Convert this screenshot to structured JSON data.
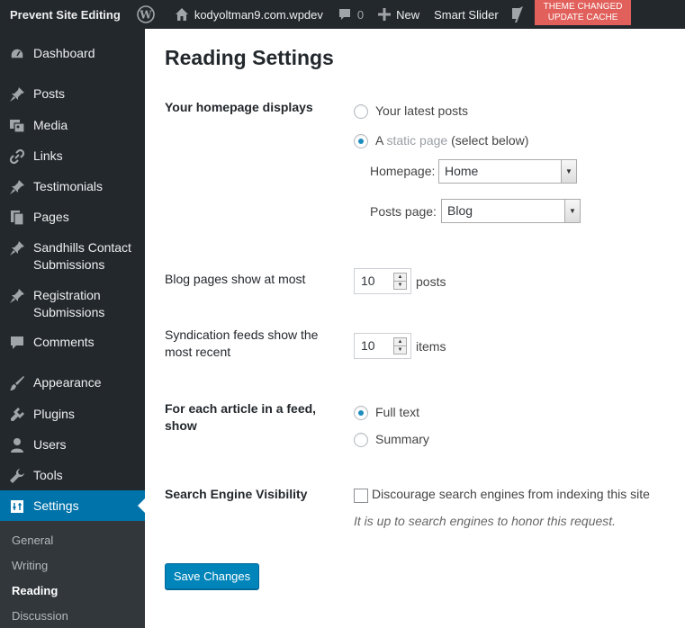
{
  "adminbar": {
    "brand": "Prevent Site Editing",
    "site_name": "kodyoltman9.com.wpdev",
    "comments_count": "0",
    "new_label": "New",
    "smart_slider_label": "Smart Slider",
    "theme_alert_line1": "THEME CHANGED",
    "theme_alert_line2": "UPDATE CACHE"
  },
  "sidebar": {
    "items": [
      {
        "label": "Dashboard",
        "icon": "dashboard-icon"
      },
      {
        "label": "Posts",
        "icon": "pin-icon"
      },
      {
        "label": "Media",
        "icon": "media-icon"
      },
      {
        "label": "Links",
        "icon": "link-icon"
      },
      {
        "label": "Testimonials",
        "icon": "pin-icon"
      },
      {
        "label": "Pages",
        "icon": "pages-icon"
      },
      {
        "label": "Sandhills Contact Submissions",
        "icon": "pin-icon"
      },
      {
        "label": "Registration Submissions",
        "icon": "pin-icon"
      },
      {
        "label": "Comments",
        "icon": "comment-icon"
      },
      {
        "label": "Appearance",
        "icon": "brush-icon"
      },
      {
        "label": "Plugins",
        "icon": "plug-icon"
      },
      {
        "label": "Users",
        "icon": "user-icon"
      },
      {
        "label": "Tools",
        "icon": "wrench-icon"
      },
      {
        "label": "Settings",
        "icon": "settings-icon"
      }
    ],
    "submenu": [
      "General",
      "Writing",
      "Reading",
      "Discussion"
    ]
  },
  "page": {
    "title": "Reading Settings",
    "homepage_displays": {
      "label": "Your homepage displays",
      "option_latest": "Your latest posts",
      "option_static_prefix": "A ",
      "option_static_link": "static page",
      "option_static_suffix": " (select below)",
      "selected": "static",
      "homepage_label": "Homepage:",
      "homepage_value": "Home",
      "posts_page_label": "Posts page:",
      "posts_page_value": "Blog"
    },
    "blog_pages": {
      "label": "Blog pages show at most",
      "value": "10",
      "unit": "posts"
    },
    "syndication": {
      "label": "Syndication feeds show the most recent",
      "value": "10",
      "unit": "items"
    },
    "feed_article": {
      "label": "For each article in a feed, show",
      "option_full": "Full text",
      "option_summary": "Summary",
      "selected": "full"
    },
    "search_visibility": {
      "label": "Search Engine Visibility",
      "checkbox_label": "Discourage search engines from indexing this site",
      "checked": false,
      "description": "It is up to search engines to honor this request."
    },
    "save_button": "Save Changes"
  },
  "colors": {
    "adminbar_bg": "#23282d",
    "sidebar_bg": "#23282d",
    "active_menu": "#0073aa",
    "primary_button": "#0085ba",
    "theme_alert": "#e1605b"
  }
}
